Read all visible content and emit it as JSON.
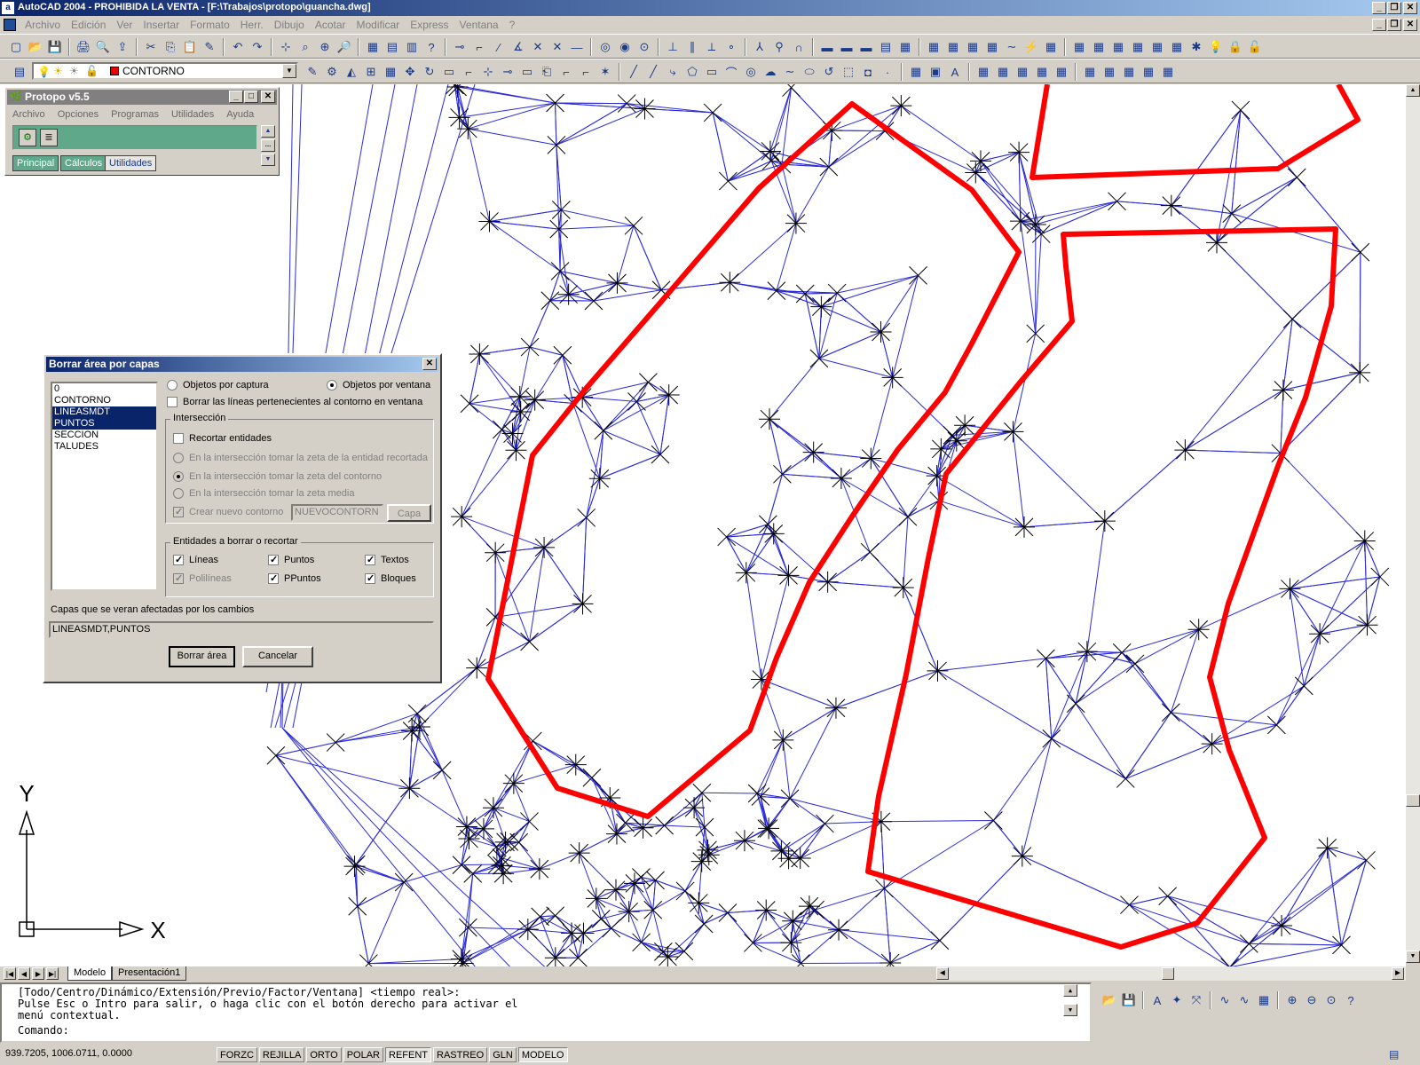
{
  "window": {
    "title": "AutoCAD 2004 - PROHIBIDA LA VENTA - [F:\\Trabajos\\protopo\\guancha.dwg]"
  },
  "menu": [
    "Archivo",
    "Edición",
    "Ver",
    "Insertar",
    "Formato",
    "Herr.",
    "Dibujo",
    "Acotar",
    "Modificar",
    "Express",
    "Ventana",
    "?"
  ],
  "layer_toolbar": {
    "current_layer": "CONTORNO",
    "layer_color": "#ff0000"
  },
  "protopo": {
    "title": "Protopo v5.5",
    "menu": [
      "Archivo",
      "Opciones",
      "Programas",
      "Utilidades",
      "Ayuda"
    ],
    "tabs": [
      "Principal",
      "Cálculos",
      "Utilidades"
    ],
    "active_tab": "Utilidades"
  },
  "dialog": {
    "title": "Borrar área por capas",
    "layers": [
      "0",
      "CONTORNO",
      "LINEASMDT",
      "PUNTOS",
      "SECCION",
      "TALUDES"
    ],
    "selected_layers": [
      "LINEASMDT",
      "PUNTOS"
    ],
    "radio_captura": "Objetos por captura",
    "radio_ventana": "Objetos por ventana",
    "selected_radio": "Objetos por ventana",
    "borrar_lineas": "Borrar las líneas pertenecientes al contorno en ventana",
    "interseccion": {
      "label": "Intersección",
      "recortar": "Recortar entidades",
      "opt1": "En la intersección tomar la zeta de la entidad recortada",
      "opt2": "En la intersección tomar la zeta del contorno",
      "opt3": "En la intersección tomar la zeta media",
      "crear": "Crear nuevo contorno",
      "nuevo_value": "NUEVOCONTORN",
      "capa_button": "Capa"
    },
    "entidades": {
      "label": "Entidades a borrar o recortar",
      "lineas": "Líneas",
      "puntos": "Puntos",
      "textos": "Textos",
      "polilineas": "Polilíneas",
      "ppuntos": "PPuntos",
      "bloques": "Bloques"
    },
    "afectadas_label": "Capas que se veran afectadas por los cambios",
    "afectadas_value": "LINEASMDT,PUNTOS",
    "ok_button": "Borrar área",
    "cancel_button": "Cancelar"
  },
  "ucs": {
    "x_label": "X",
    "y_label": "Y"
  },
  "layout_tabs": [
    "Modelo",
    "Presentación1"
  ],
  "command": {
    "line1": "[Todo/Centro/Dinámico/Extensión/Previo/Factor/Ventana] <tiempo real>:",
    "line2": "Pulse Esc o Intro para salir, o haga clic con el botón derecho para activar el",
    "line3": "menú contextual.",
    "prompt": "Comando:"
  },
  "status": {
    "coords": "939.7205, 1006.0711, 0.0000",
    "modes": [
      "FORZC",
      "REJILLA",
      "ORTO",
      "POLAR",
      "REFENT",
      "RASTREO",
      "GLN",
      "MODELO"
    ],
    "active_modes": [
      "REFENT",
      "MODELO"
    ]
  },
  "colors": {
    "contour": "#ff0000",
    "mesh": "#2b2bd8",
    "titlebar": "#0a246a"
  }
}
